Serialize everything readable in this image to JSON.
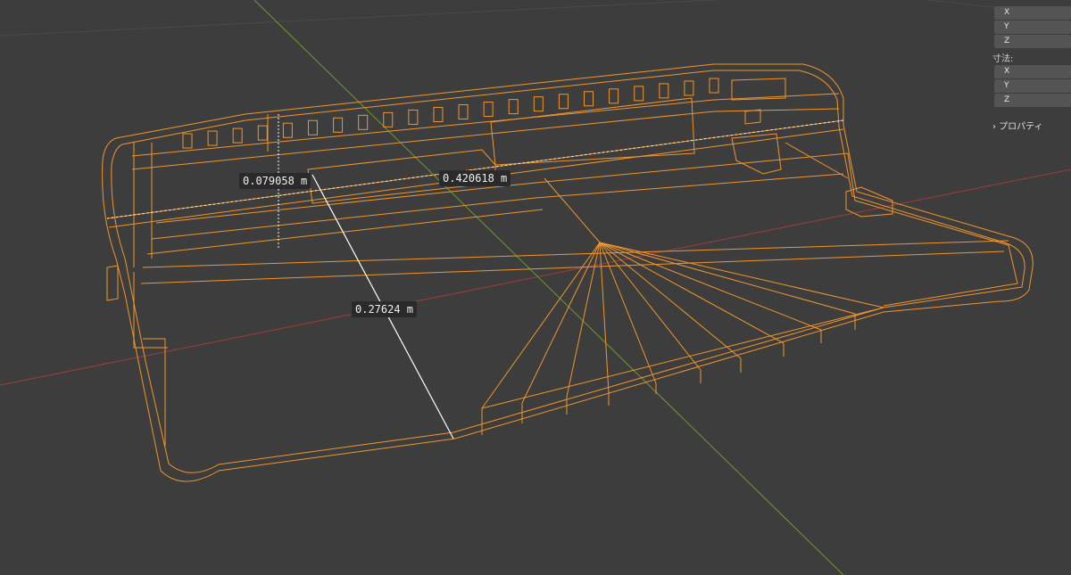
{
  "viewport": {
    "dimensions": {
      "label_a": "0.079058 m",
      "label_b": "0.420618 m",
      "label_c": "0.27624 m"
    },
    "colors": {
      "background": "#3d3d3d",
      "x_axis": "#a23b3b",
      "y_axis": "#6b9a2f",
      "wireframe": "#f0962b",
      "measure": "#ffffff"
    }
  },
  "side_panel": {
    "top_header": "",
    "top_fields": [
      "X",
      "Y",
      "Z"
    ],
    "dimensions_header": "寸法:",
    "dimensions_fields": [
      "X",
      "Y",
      "Z"
    ],
    "properties_label": "プロパティ",
    "properties_icon": "chevron-right-icon"
  }
}
